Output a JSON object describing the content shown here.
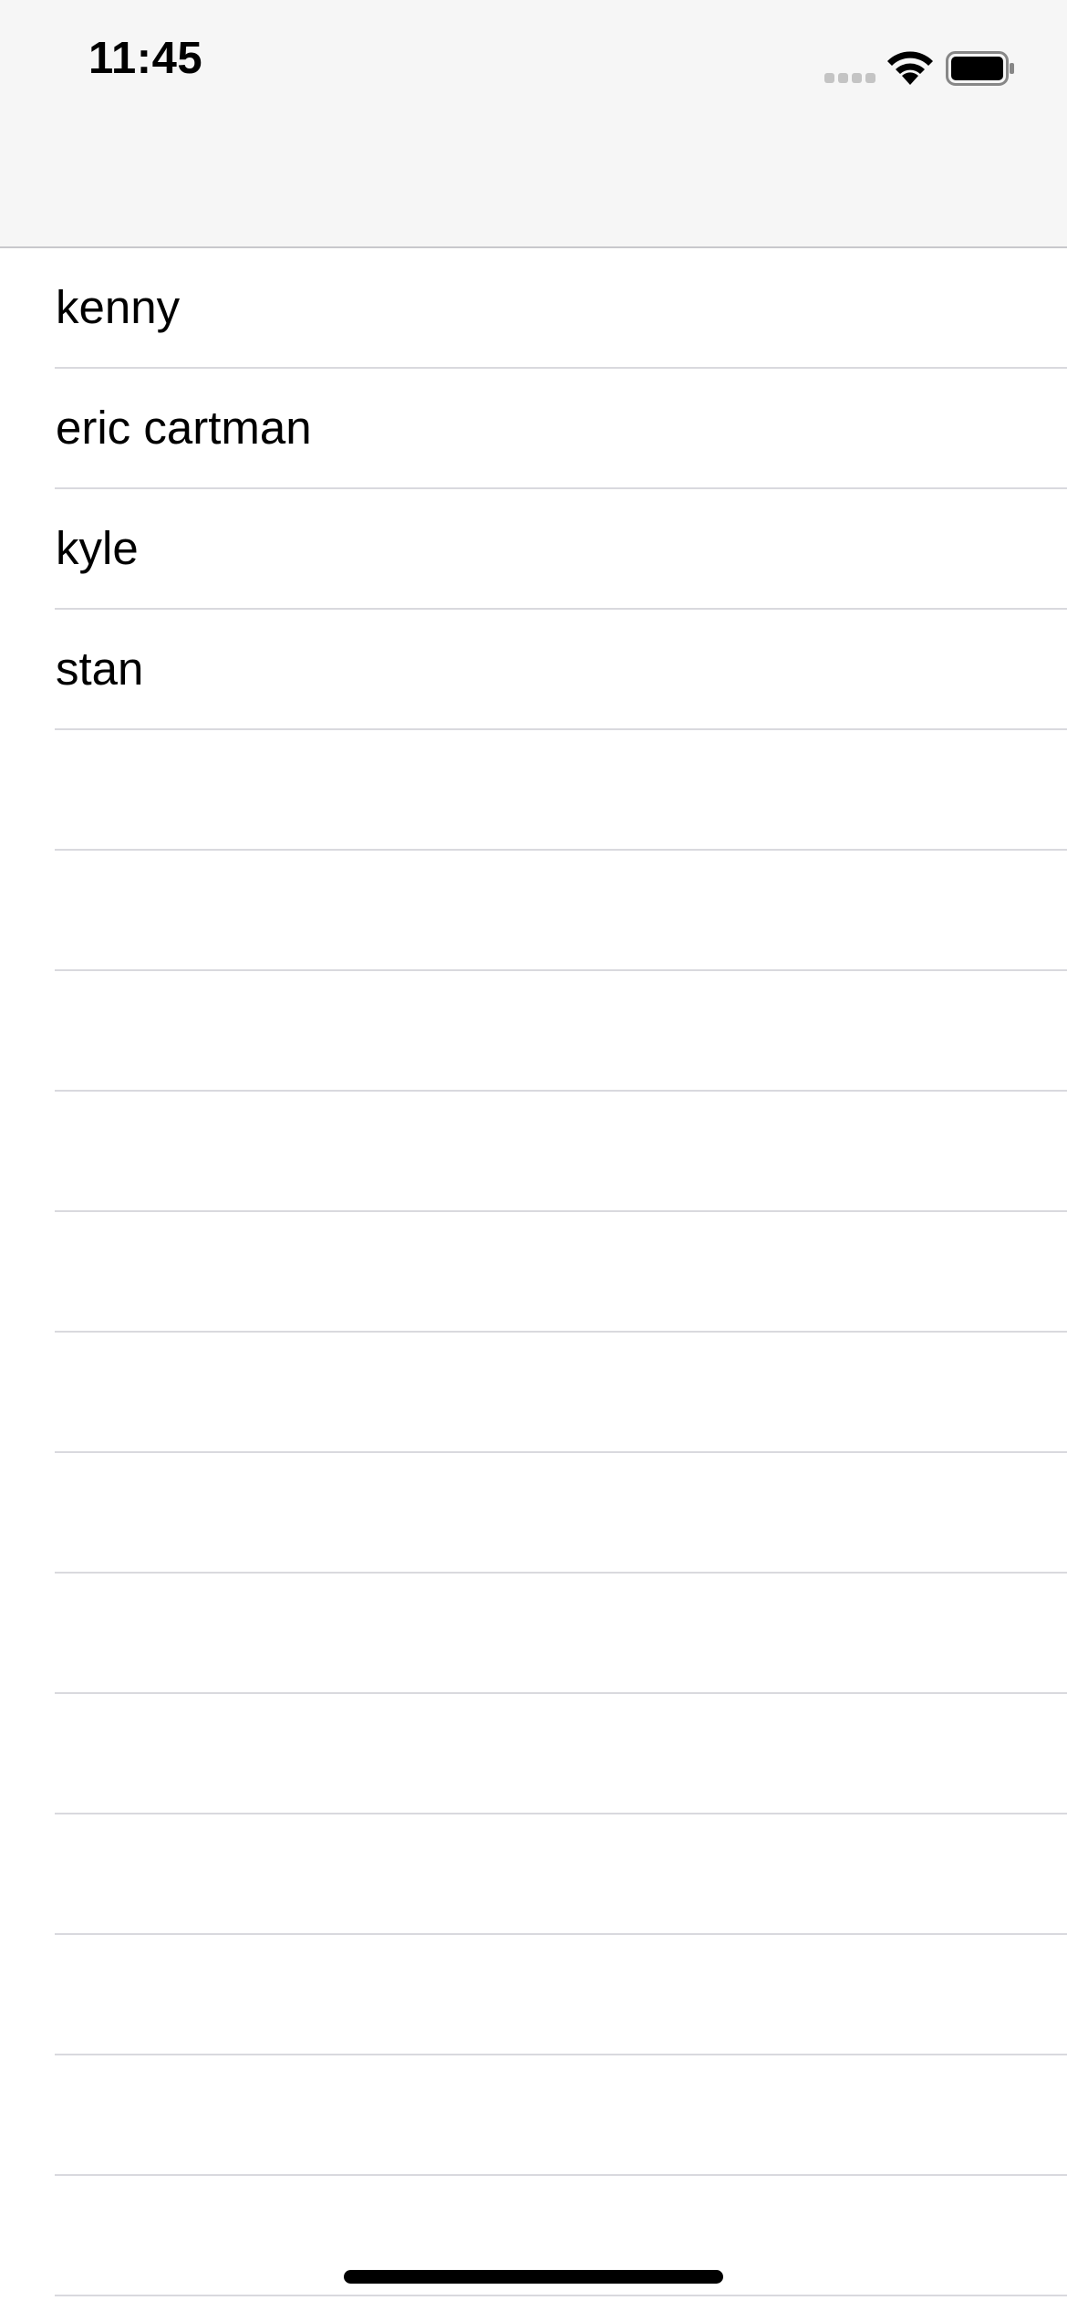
{
  "status_bar": {
    "time": "11:45",
    "signal_icon": "cellular-signal-empty-icon",
    "wifi_icon": "wifi-icon",
    "battery_icon": "battery-full-icon"
  },
  "nav_bar": {
    "title": ""
  },
  "list": {
    "items": [
      {
        "label": "kenny"
      },
      {
        "label": "eric cartman"
      },
      {
        "label": "kyle"
      },
      {
        "label": "stan"
      },
      {
        "label": ""
      },
      {
        "label": ""
      },
      {
        "label": ""
      },
      {
        "label": ""
      },
      {
        "label": ""
      },
      {
        "label": ""
      },
      {
        "label": ""
      },
      {
        "label": ""
      },
      {
        "label": ""
      },
      {
        "label": ""
      },
      {
        "label": ""
      },
      {
        "label": ""
      },
      {
        "label": ""
      }
    ]
  },
  "colors": {
    "bar_background": "#f6f6f6",
    "separator": "#d9d9de",
    "text": "#000000"
  }
}
